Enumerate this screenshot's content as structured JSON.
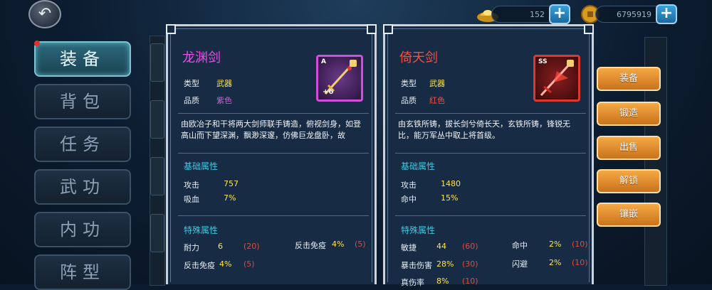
{
  "top": {
    "ingot": {
      "value": "152",
      "icon": "gold-ingot-icon"
    },
    "coins": {
      "value": "6795919",
      "icon": "coin-icon"
    },
    "plus": "+",
    "back": "↶"
  },
  "tabs": [
    "装备",
    "背包",
    "任务",
    "武功",
    "内功",
    "阵型"
  ],
  "panels": [
    {
      "name": "龙渊剑",
      "name_color": "#e94ee6",
      "type_label": "类型",
      "type_value": "武器",
      "quality_label": "品质",
      "quality_value": "紫色",
      "quality_color": "#e94ee6",
      "grade": "A",
      "enhance": "+6",
      "description": "由欧冶子和干将两大剑师联手铸造，俯视剑身，如登高山而下望深渊，飘渺深邃，仿佛巨龙盘卧，故",
      "base_title": "基础属性",
      "base": [
        {
          "label": "攻击",
          "value": "757"
        },
        {
          "label": "吸血",
          "value": "7%"
        }
      ],
      "special_title": "特殊属性",
      "special": [
        {
          "label": "耐力",
          "value": "6",
          "max": "(20)"
        },
        {
          "label": "反击免疫",
          "value": "4%",
          "max": "(5)"
        },
        {
          "label": "反击免疫",
          "value": "4%",
          "max": "(5)"
        }
      ]
    },
    {
      "name": "倚天剑",
      "name_color": "#ff4b3c",
      "type_label": "类型",
      "type_value": "武器",
      "quality_label": "品质",
      "quality_value": "红色",
      "quality_color": "#ff4b3c",
      "grade": "SS",
      "description": "由玄铁所铸，拔长剑兮倚长天，玄铁所铸，锋锐无比，能万军丛中取上将首级。",
      "base_title": "基础属性",
      "base": [
        {
          "label": "攻击",
          "value": "1480"
        },
        {
          "label": "命中",
          "value": "15%"
        }
      ],
      "special_title": "特殊属性",
      "special": [
        {
          "label": "敏捷",
          "value": "44",
          "max": "(60)"
        },
        {
          "label": "命中",
          "value": "2%",
          "max": "(10)"
        },
        {
          "label": "暴击伤害",
          "value": "28%",
          "max": "(30)"
        },
        {
          "label": "闪避",
          "value": "2%",
          "max": "(10)"
        },
        {
          "label": "真伤率",
          "value": "8%",
          "max": "(10)"
        }
      ]
    }
  ],
  "actions": [
    "装备",
    "锻造",
    "出售",
    "解锁",
    "镶嵌"
  ]
}
